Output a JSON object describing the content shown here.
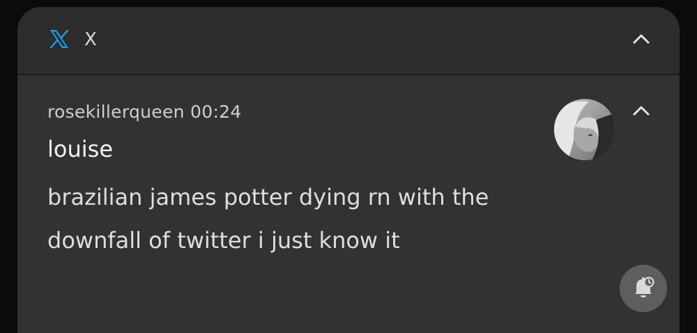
{
  "notification": {
    "app": {
      "icon": "x-logo-icon",
      "name": "X",
      "accent_color": "#1d9bf0"
    },
    "collapse_icon": "chevron-up-icon",
    "message": {
      "account": "rosekillerqueen",
      "time": "00:24",
      "sender": "louise",
      "body": "brazilian james potter dying rn with the downfall of twitter i just know it",
      "avatar": "profile-avatar",
      "snooze_icon": "bell-snooze-icon"
    }
  }
}
